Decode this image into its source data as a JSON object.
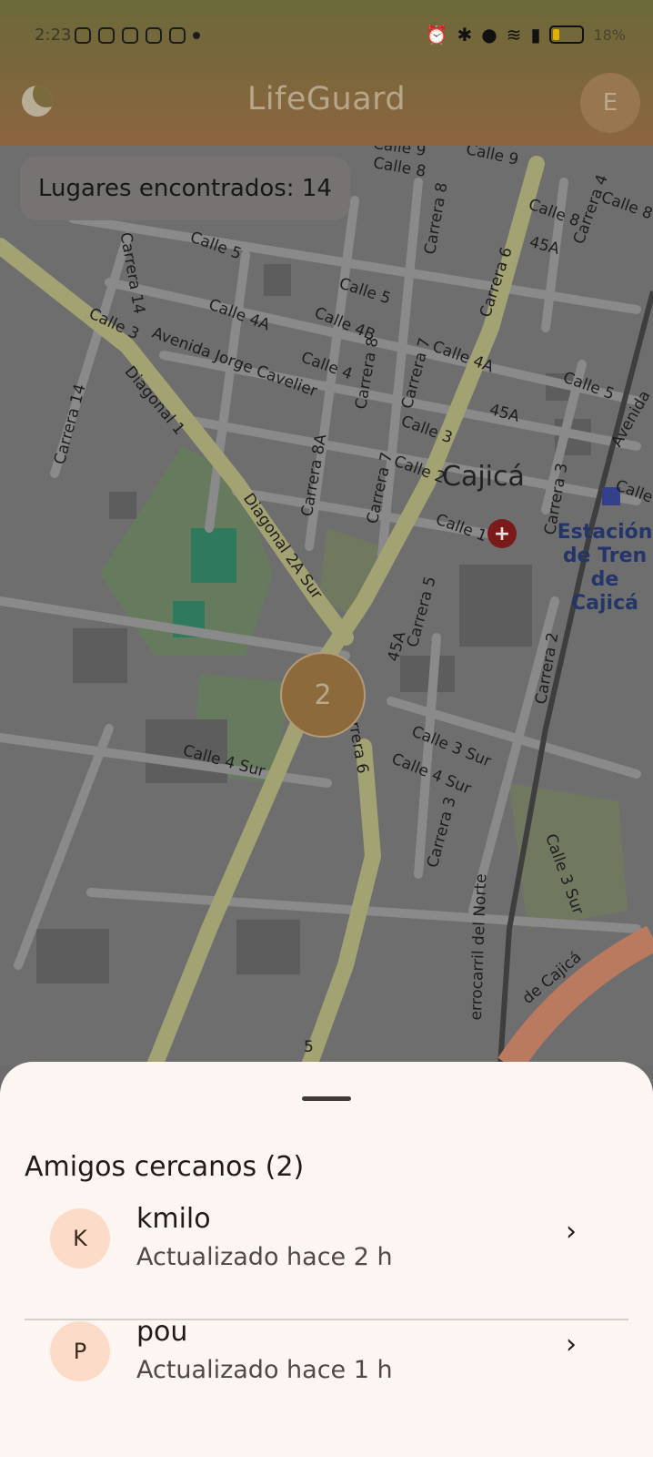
{
  "status_bar": {
    "time": "2:23",
    "battery": "18%"
  },
  "app_bar": {
    "title": "LifeGuard",
    "avatar_initial": "E",
    "theme_icon": "moon-icon"
  },
  "map": {
    "places_found": "Lugares encontrados: 14",
    "cluster_count": "2",
    "city_label": "Cajicá",
    "station_label": [
      "Estación",
      "de Tren",
      "de Cajicá"
    ],
    "street_labels": [
      "Calle 9",
      "Calle 8",
      "Calle 9",
      "Carrera 8",
      "Calle 8",
      "Calle 8",
      "Carrera 4",
      "45A",
      "Calle 5",
      "Calle 5",
      "Carrera 14",
      "Calle 4A",
      "Calle 4B",
      "Calle 3",
      "Avenida Jorge Cavelier",
      "Calle 4",
      "Carrera 8",
      "Carrera 7",
      "Calle 4A",
      "Carrera 6",
      "Calle 5",
      "Diagonal 1",
      "Carrera 14",
      "45A",
      "Calle 3",
      "Carrera 8A",
      "Calle 2",
      "Carrera 7",
      "Carrera 3",
      "Calle 1",
      "Diagonal 2A Sur",
      "Carrera 5",
      "45A",
      "Carrera 2",
      "Calle 3 Sur",
      "Calle 4 Sur",
      "Calle 4 Sur",
      "Carrera 3",
      "Carrera 6",
      "Calle 3 Sur",
      "errocarril del Norte",
      "de Cajicá",
      "Avenida",
      "Calle",
      "5"
    ]
  },
  "sheet": {
    "title": "Amigos cercanos (2)",
    "friends": [
      {
        "initial": "K",
        "name": "kmilo",
        "updated": "Actualizado hace 2 h"
      },
      {
        "initial": "P",
        "name": "pou",
        "updated": "Actualizado hace 1 h"
      }
    ]
  },
  "colors": {
    "header": "#7a663c",
    "sheet_bg": "#fcf5f2",
    "avatar_bg": "#fcdcc8",
    "cluster": "#8c6a3c"
  }
}
